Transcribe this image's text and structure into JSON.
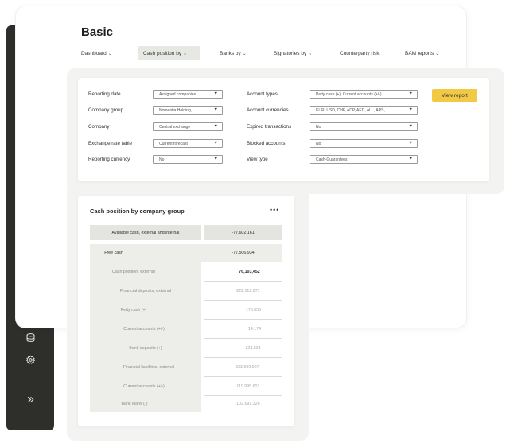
{
  "header": {
    "title": "Basic",
    "nav": [
      {
        "label": "Dashboard",
        "chev": "⌄"
      },
      {
        "label": "Cash position by",
        "chev": "⌄"
      },
      {
        "label": "Banks by",
        "chev": "⌄"
      },
      {
        "label": "Signatories by",
        "chev": "⌄"
      },
      {
        "label": "Counterparty risk",
        "chev": ""
      },
      {
        "label": "BAM reports",
        "chev": "⌄"
      }
    ]
  },
  "filters": {
    "left": [
      {
        "label": "Reporting date",
        "value": "Assigned companies"
      },
      {
        "label": "Company group",
        "value": "Nomentia Holding, ..."
      },
      {
        "label": "Company",
        "value": "Central exchange"
      },
      {
        "label": "Exchange rate table",
        "value": "Current forecast"
      },
      {
        "label": "Reporting currency",
        "value": "No"
      }
    ],
    "right": [
      {
        "label": "Account types",
        "value": "Petty cash (+), Current accounts (+/-)"
      },
      {
        "label": "Account currencies",
        "value": "EUR, USD, CHF, ADP, AED, ALL, ARS, ..."
      },
      {
        "label": "Expired transactions",
        "value": "No"
      },
      {
        "label": "Blocked accounts",
        "value": "No"
      },
      {
        "label": "View type",
        "value": "Cash-Guarantees"
      }
    ],
    "arrow": "▼",
    "view_report_label": "View report"
  },
  "report": {
    "title": "Cash position by company group",
    "more": "•••",
    "rows": [
      {
        "label": "Available cash, external and internal",
        "value": "-77.602.161"
      },
      {
        "label": "Free cash",
        "value": "-77.506.934"
      },
      {
        "label": "Cash position, external",
        "value": "76,103,452"
      },
      {
        "label": "Financial deposits, external",
        "value": "-222.512.271"
      },
      {
        "label": "Petty cash (+)",
        "value": "178.656"
      },
      {
        "label": "Current accounts (+/-)",
        "value": "14.174"
      },
      {
        "label": "Bank deposits (+)",
        "value": "123.523"
      },
      {
        "label": "Financial liabilities, external",
        "value": "-333.690.927"
      },
      {
        "label": "Current accounts (+/-)",
        "value": "-119.995.601"
      },
      {
        "label": "Bank loans (-)",
        "value": "-102.691.326"
      }
    ]
  },
  "colors": {
    "sidebar_bg": "#2e2f2b",
    "accent_yellow": "#f1c944",
    "active_icon": "#e0b82c"
  },
  "sidebar_icons": [
    "location-pin-icon",
    "star-icon",
    "checklist-icon",
    "currency-exchange-icon",
    "bar-chart-icon",
    "shield-icon",
    "document-icon",
    "search-money-icon",
    "report-icon",
    "network-icon",
    "database-stack-icon",
    "database-icon",
    "settings-icon",
    "expand-icon"
  ]
}
